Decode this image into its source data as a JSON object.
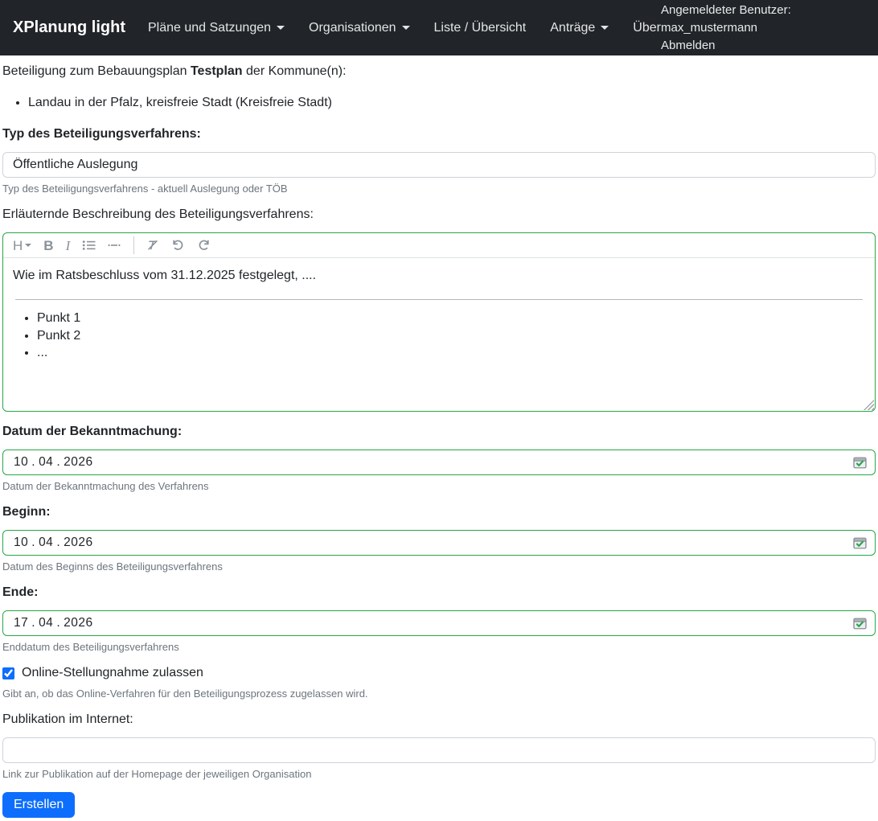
{
  "colors": {
    "navbar_bg": "#212529",
    "primary_blue": "#0d6efd",
    "valid_green": "#28a745",
    "muted_text": "#6c757d",
    "input_border_gray": "#ced4da"
  },
  "navbar": {
    "brand": "XPlanung light",
    "items": [
      {
        "label": "Pläne und Satzungen",
        "dropdown": true
      },
      {
        "label": "Organisationen",
        "dropdown": true
      },
      {
        "label": "Liste / Übersicht",
        "dropdown": false
      },
      {
        "label": "Anträge",
        "dropdown": true
      },
      {
        "label": "Über",
        "dropdown": false
      }
    ],
    "user_info": "Angemeldeter Benutzer: max_mustermann",
    "logout_label": "Abmelden"
  },
  "form": {
    "intro": {
      "prefix": "Beteiligung zum Bebauungsplan",
      "plan_name": "Testplan",
      "suffix": "der Kommune(n):"
    },
    "municipalities": [
      "Landau in der Pfalz, kreisfreie Stadt (Kreisfreie Stadt)"
    ],
    "type_field": {
      "label": "Typ des Beteiligungsverfahrens:",
      "value": "Öffentliche Auslegung",
      "help": "Typ des Beteiligungsverfahrens - aktuell Auslegung oder TÖB"
    },
    "description_field": {
      "label": "Erläuternde Beschreibung des Beteiligungsverfahrens:",
      "toolbar": {
        "heading_glyph": "H",
        "bold_glyph": "B",
        "italic_glyph": "I"
      },
      "paragraph": "Wie im Ratsbeschluss vom 31.12.2025 festgelegt, ....",
      "list_items": [
        "Punkt 1",
        "Punkt 2",
        "..."
      ]
    },
    "announcement_date": {
      "label": "Datum der Bekanntmachung:",
      "day": "10",
      "month": "04",
      "year": "2026",
      "sep": ".",
      "help": "Datum der Bekanntmachung des Verfahrens"
    },
    "start_date": {
      "label": "Beginn:",
      "day": "10",
      "month": "04",
      "year": "2026",
      "sep": ".",
      "help": "Datum des Beginns des Beteiligungsverfahrens"
    },
    "end_date": {
      "label": "Ende:",
      "day": "17",
      "month": "04",
      "year": "2026",
      "sep": ".",
      "help": "Enddatum des Beteiligungsverfahrens"
    },
    "online_checkbox": {
      "label": "Online-Stellungnahme zulassen",
      "checked": true,
      "help": "Gibt an, ob das Online-Verfahren für den Beteiligungsprozess zugelassen wird."
    },
    "publication_field": {
      "label": "Publikation im Internet:",
      "value": "",
      "help": "Link zur Publikation auf der Homepage der jeweiligen Organisation"
    },
    "submit_label": "Erstellen"
  }
}
